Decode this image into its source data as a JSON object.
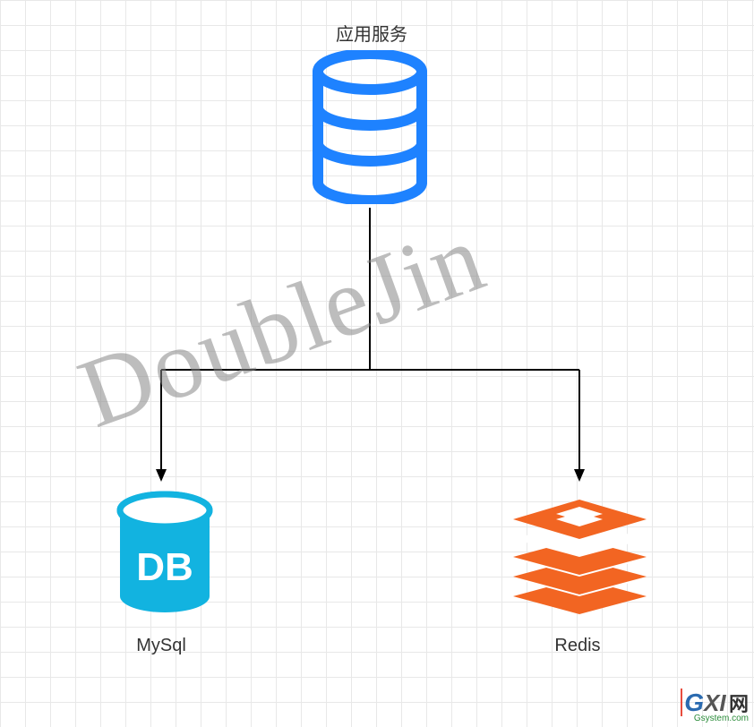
{
  "diagram": {
    "title": "应用服务",
    "nodes": {
      "app": {
        "label": "应用服务",
        "icon": "database-outline",
        "color": "#1e82ff"
      },
      "mysql": {
        "label": "MySql",
        "icon": "database-cylinder",
        "color": "#12b3e0",
        "db_text": "DB"
      },
      "redis": {
        "label": "Redis",
        "icon": "redis-stack",
        "color": "#f26522"
      }
    },
    "edges": [
      {
        "from": "app",
        "to": "mysql"
      },
      {
        "from": "app",
        "to": "redis"
      }
    ],
    "watermark": "DoubleJin",
    "site": {
      "brand_g": "G",
      "brand_xi": "XI",
      "brand_cn": "网",
      "brand_sub": "Gsystem.com"
    }
  }
}
